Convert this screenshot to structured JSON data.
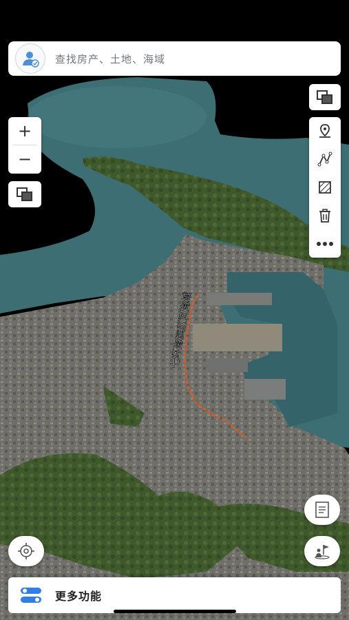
{
  "search": {
    "placeholder": "查找房产、土地、海域"
  },
  "map": {
    "label_road": "七环海滨区间海域"
  },
  "toolbar": {
    "icons": [
      "layers-icon",
      "location-pin-icon",
      "polyline-icon",
      "polygon-area-icon",
      "trash-icon",
      "more-icon"
    ]
  },
  "zoom": {
    "in_label": "+",
    "out_label": "−"
  },
  "bottom_bar": {
    "label": "更多功能"
  },
  "colors": {
    "water": "#3d6e73",
    "land": "#6d6d63",
    "forest": "#3f5a2b",
    "route": "#d35a2a"
  }
}
